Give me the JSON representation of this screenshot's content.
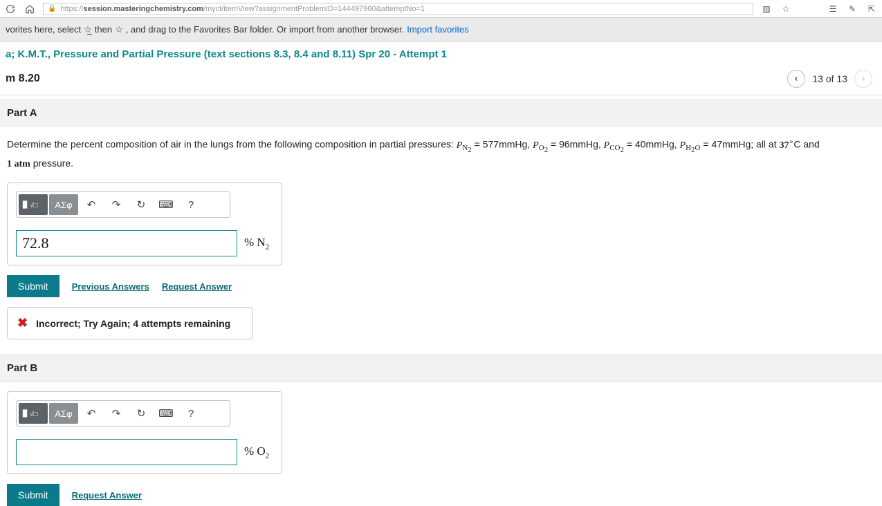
{
  "browser": {
    "url_plain_left": "https://",
    "url_domain": "session.masteringchemistry.com",
    "url_path": "/myct/itemView?assignmentProblemID=144497960&attemptNo=1"
  },
  "favbar": {
    "text1": "vorites here, select",
    "text2": "then",
    "text3": ", and drag to the Favorites Bar folder. Or import from another browser.",
    "link": "Import favorites"
  },
  "assignment": {
    "title": "a; K.M.T., Pressure and Partial Pressure (text sections 8.3, 8.4 and 8.11) Spr 20 - Attempt 1",
    "problem": "m 8.20",
    "counter": "13 of 13"
  },
  "partA": {
    "label": "Part A",
    "text_lead": "Determine the percent composition of air in the lungs from the following composition in partial pressures: ",
    "pn2_eq": " = 577mmHg, ",
    "po2_eq": " = 96mmHg, ",
    "pco2_eq": " = 40mmHg, ",
    "ph2o_eq": " = 47mmHg; all at ",
    "temp": "37",
    "temp_unit": "C and ",
    "atm": "1 atm",
    "tail": " pressure.",
    "input_value": "72.8",
    "unit_prefix": "% N",
    "unit_sub": "2",
    "toolbar": {
      "greek": "ΑΣφ",
      "help": "?"
    },
    "submit": "Submit",
    "prev": "Previous Answers",
    "request": "Request Answer",
    "feedback": "Incorrect; Try Again; 4 attempts remaining"
  },
  "partB": {
    "label": "Part B",
    "input_value": "",
    "unit_prefix": "% O",
    "unit_sub": "2",
    "toolbar": {
      "greek": "ΑΣφ",
      "help": "?"
    },
    "submit": "Submit",
    "request": "Request Answer"
  }
}
